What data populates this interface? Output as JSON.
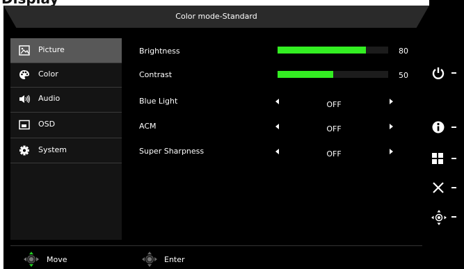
{
  "header": {
    "title": "Color mode-Standard"
  },
  "sidebar": {
    "items": [
      {
        "label": "Picture",
        "icon": "picture-icon",
        "selected": true
      },
      {
        "label": "Color",
        "icon": "palette-icon",
        "selected": false
      },
      {
        "label": "Audio",
        "icon": "speaker-icon",
        "selected": false
      },
      {
        "label": "OSD",
        "icon": "osd-icon",
        "selected": false
      },
      {
        "label": "System",
        "icon": "gear-icon",
        "selected": false
      }
    ]
  },
  "settings": {
    "brightness": {
      "label": "Brightness",
      "value": "80",
      "level": 0.8
    },
    "contrast": {
      "label": "Contrast",
      "value": "50",
      "level": 0.5
    },
    "blue_light": {
      "label": "Blue Light",
      "value": "OFF"
    },
    "acm": {
      "label": "ACM",
      "value": "OFF"
    },
    "super_sharpness": {
      "label": "Super Sharpness",
      "value": "OFF"
    }
  },
  "footer": {
    "move_label": "Move",
    "enter_label": "Enter"
  },
  "hardware_buttons": [
    "power-icon",
    "info-icon",
    "grid-icon",
    "close-icon",
    "joystick-icon"
  ],
  "colors": {
    "bar_fill": "#33ee22",
    "selected_bg": "#585858",
    "accent_arrow": "#22cc22"
  }
}
